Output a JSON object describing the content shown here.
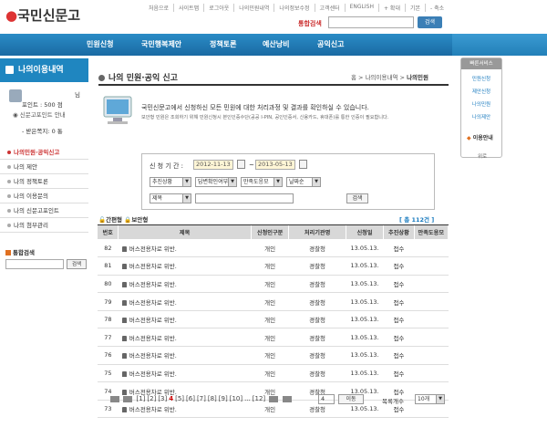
{
  "header": {
    "logo_text": "국민신문고",
    "top_links": [
      "처음으로",
      "사이트맵",
      "로그아웃",
      "나의민원내역",
      "나의정보수정",
      "고객센터",
      "ENGLISH",
      "+ 확대",
      "기본",
      "- 축소"
    ],
    "search_label": "통합검색",
    "search_placeholder": "",
    "search_button": "검색"
  },
  "nav": {
    "items": [
      "민원신청",
      "국민행복제안",
      "정책토론",
      "예산낭비",
      "공익신고"
    ]
  },
  "sidebar": {
    "title": "나의이용내역",
    "user_suffix": "님",
    "points_label": "포인트 : 500 점",
    "points_guide": "신문고포인트 안내",
    "received_label": "- 받은쪽지: 0 통",
    "menu": [
      "나의민원·공익신고",
      "나의 제안",
      "나의 정책토론",
      "나의 이용문의",
      "나의 신문고포인트",
      "나의 첨부관리"
    ],
    "search_label": "통합검색",
    "search_button": "검색"
  },
  "main": {
    "title": "나의 민원·공익 신고",
    "breadcrumb": [
      "홈",
      "나의이용내역",
      "나의민원"
    ],
    "intro_main": "국민신문고에서 신청하신 모든 민원에 대한 처리과정 및 결과를 확인하실 수 있습니다.",
    "intro_sub": "보안형 민원은 조회하기 위해 민원신청시 본인인증수단(공공 I-PIN, 공인인증서, 신용카드, 휴대폰)를 통한 인증이 필요합니다."
  },
  "filter": {
    "period_label": "신 청 기 간 :",
    "date_from": "2012-11-13",
    "date_sep": "~",
    "date_to": "2013-05-13",
    "select_status": "추진상황",
    "select_answer": "답변확인여부",
    "select_satisfaction": "만족도응모",
    "select_sort": "날짜순",
    "select_field": "제목",
    "search_value": "",
    "search_button": "검색"
  },
  "table": {
    "legend_simple": "간편형",
    "legend_secure": "보안형",
    "count_text": "[ 총 112건 ]",
    "columns": [
      "번호",
      "제목",
      "신청인구분",
      "처리기관명",
      "신청일",
      "추진상황",
      "만족도응모"
    ],
    "rows": [
      {
        "no": "82",
        "title": "버스전용차로 위반.",
        "applicant": "개인",
        "agency": "경찰청",
        "date": "13.05.13.",
        "status": "접수",
        "sat": ""
      },
      {
        "no": "81",
        "title": "버스전용차로 위반.",
        "applicant": "개인",
        "agency": "경찰청",
        "date": "13.05.13.",
        "status": "접수",
        "sat": ""
      },
      {
        "no": "80",
        "title": "버스전용차로 위반.",
        "applicant": "개인",
        "agency": "경찰청",
        "date": "13.05.13.",
        "status": "접수",
        "sat": ""
      },
      {
        "no": "79",
        "title": "버스전용차로 위반.",
        "applicant": "개인",
        "agency": "경찰청",
        "date": "13.05.13.",
        "status": "접수",
        "sat": ""
      },
      {
        "no": "78",
        "title": "버스전용차로 위반.",
        "applicant": "개인",
        "agency": "경찰청",
        "date": "13.05.13.",
        "status": "접수",
        "sat": ""
      },
      {
        "no": "77",
        "title": "버스전용차로 위반.",
        "applicant": "개인",
        "agency": "경찰청",
        "date": "13.05.13.",
        "status": "접수",
        "sat": ""
      },
      {
        "no": "76",
        "title": "버스전용차로 위반.",
        "applicant": "개인",
        "agency": "경찰청",
        "date": "13.05.13.",
        "status": "접수",
        "sat": ""
      },
      {
        "no": "75",
        "title": "버스전용차로 위반.",
        "applicant": "개인",
        "agency": "경찰청",
        "date": "13.05.13.",
        "status": "접수",
        "sat": ""
      },
      {
        "no": "74",
        "title": "버스전용차로 위반.",
        "applicant": "개인",
        "agency": "경찰청",
        "date": "13.05.13.",
        "status": "접수",
        "sat": ""
      },
      {
        "no": "73",
        "title": "버스전용차로 위반.",
        "applicant": "개인",
        "agency": "경찰청",
        "date": "13.05.13.",
        "status": "접수",
        "sat": ""
      }
    ]
  },
  "pager": {
    "pages": [
      "[1]",
      "[2]",
      "[3]",
      "4",
      "[5]",
      "[6]",
      "[7]",
      "[8]",
      "[9]",
      "[10]",
      "...",
      "[12]"
    ],
    "current": "4",
    "input_value": "4",
    "go_button": "이동",
    "pagesize_label": "목록개수",
    "pagesize_value": "10개"
  },
  "right_panel": {
    "header": "빠른서비스",
    "items": [
      "민원신청",
      "제안신청",
      "나의민원",
      "나의제안"
    ],
    "guide": "이용안내",
    "top": "위로"
  },
  "colors": {
    "nav_blue": "#1f86c0",
    "accent_red": "#cc3333",
    "date_bg": "#fff6d6"
  }
}
